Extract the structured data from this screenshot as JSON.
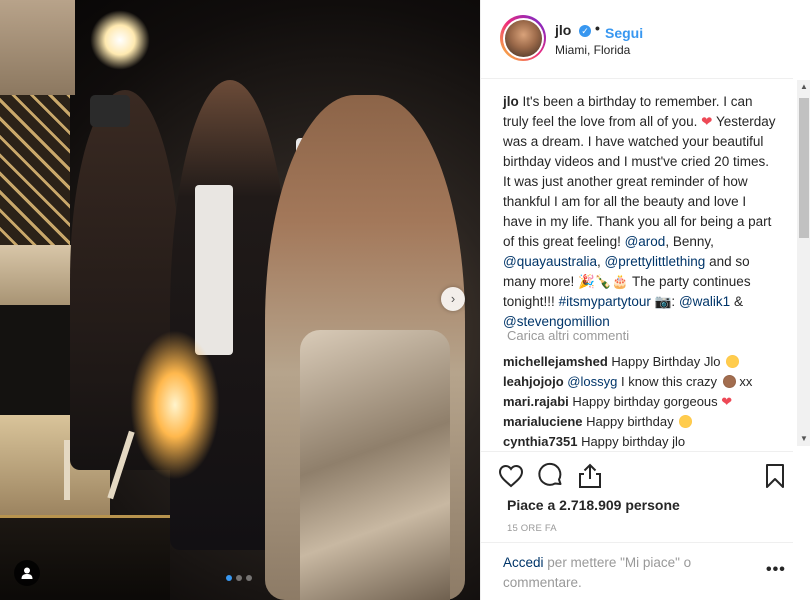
{
  "post": {
    "username": "jlo",
    "verified_badge": "✓",
    "separator": "•",
    "follow_label": "Segui",
    "location": "Miami, Florida"
  },
  "caption": {
    "username": "jlo",
    "text_1": "It's been a birthday to remember. I can truly feel the love from all of you.",
    "heart": "❤",
    "text_2": "Yesterday was a dream. I have watched your beautiful birthday videos and I must've cried 20 times. It was just another great reminder of how thankful I am for all the beauty and love I have in my life. Thank you all for being a part of this great feeling!",
    "tag_arod": "@arod",
    "text_3": ", Benny,",
    "tag_quay": "@quayaustralia",
    "text_4": ",",
    "tag_plt": "@prettylittlething",
    "text_5": "and so many more!",
    "emojis": "🎉🍾🎂",
    "text_6": "The party continues tonight!!!",
    "hashtag": "#itsmypartytour",
    "camera_emoji": "📷",
    "text_7": ":",
    "tag_walik": "@walik1",
    "amp": "&",
    "tag_steven": "@stevengomillion"
  },
  "load_more_label": "Carica altri commenti",
  "comments": [
    {
      "user": "michellejamshed",
      "text": "Happy Birthday Jlo",
      "icon": "heart-eyes-emoji"
    },
    {
      "user": "leahjojojo",
      "mention": "@lossyg",
      "text": "I know this crazy",
      "icon": "see-no-evil-monkey-emoji",
      "tail": "xx"
    },
    {
      "user": "mari.rajabi",
      "text": "Happy birthday gorgeous",
      "icon": "red-heart-emoji"
    },
    {
      "user": "marialuciene",
      "text": "Happy birthday",
      "icon": "smiling-face-emoji"
    },
    {
      "user": "cynthia7351",
      "text": "Happy birthday jlo",
      "icon": ""
    }
  ],
  "likes": "Piace a 2.718.909 persone",
  "time": "15 ORE FA",
  "add_comment": {
    "link": "Accedi",
    "text": "per mettere \"Mi piace\" o commentare."
  },
  "more_label": "•••",
  "slide_arrow": "›",
  "icons": {
    "like": "heart-outline-icon",
    "comment": "speech-bubble-icon",
    "share": "share-icon",
    "save": "bookmark-icon",
    "tagged_user": "user-icon"
  },
  "colors": {
    "link_blue": "#3897f0",
    "tag_blue": "#003569",
    "muted_gray": "#999999",
    "text": "#262626",
    "heart_red": "#ed4956"
  }
}
